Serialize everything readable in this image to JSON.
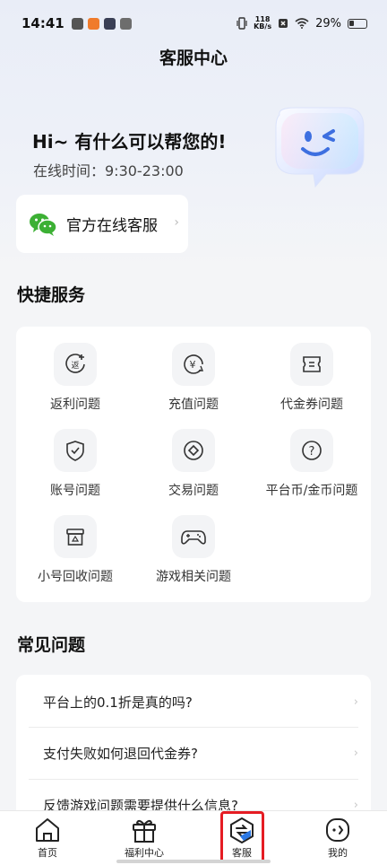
{
  "status_bar": {
    "time": "14:41",
    "net_speed_value": "118",
    "net_speed_unit": "KB/s",
    "battery": "29%"
  },
  "header": {
    "title": "客服中心"
  },
  "hero": {
    "greeting": "Hi~ 有什么可以帮您的!",
    "online_time": "在线时间：9:30-23:00"
  },
  "wechat": {
    "label": "官方在线客服"
  },
  "quick_services": {
    "title": "快捷服务",
    "items": [
      {
        "label": "返利问题",
        "icon": "rebate-icon"
      },
      {
        "label": "充值问题",
        "icon": "recharge-icon"
      },
      {
        "label": "代金券问题",
        "icon": "voucher-icon"
      },
      {
        "label": "账号问题",
        "icon": "account-shield-icon"
      },
      {
        "label": "交易问题",
        "icon": "trade-diamond-icon"
      },
      {
        "label": "平台币/金币问题",
        "icon": "question-coin-icon"
      },
      {
        "label": "小号回收问题",
        "icon": "recycle-box-icon"
      },
      {
        "label": "游戏相关问题",
        "icon": "gamepad-icon"
      }
    ]
  },
  "faq": {
    "title": "常见问题",
    "items": [
      {
        "label": "平台上的0.1折是真的吗?"
      },
      {
        "label": "支付失败如何退回代金券?"
      },
      {
        "label": "反馈游戏问题需要提供什么信息?"
      }
    ]
  },
  "tab_bar": {
    "items": [
      {
        "label": "首页",
        "icon": "home-icon"
      },
      {
        "label": "福利中心",
        "icon": "gift-icon"
      },
      {
        "label": "客服",
        "icon": "service-icon",
        "active": true
      },
      {
        "label": "我的",
        "icon": "profile-icon"
      }
    ]
  },
  "colors": {
    "highlight": "#e51c23",
    "wechat_green": "#3cb034",
    "mascot_blue": "#5b8cf0"
  }
}
